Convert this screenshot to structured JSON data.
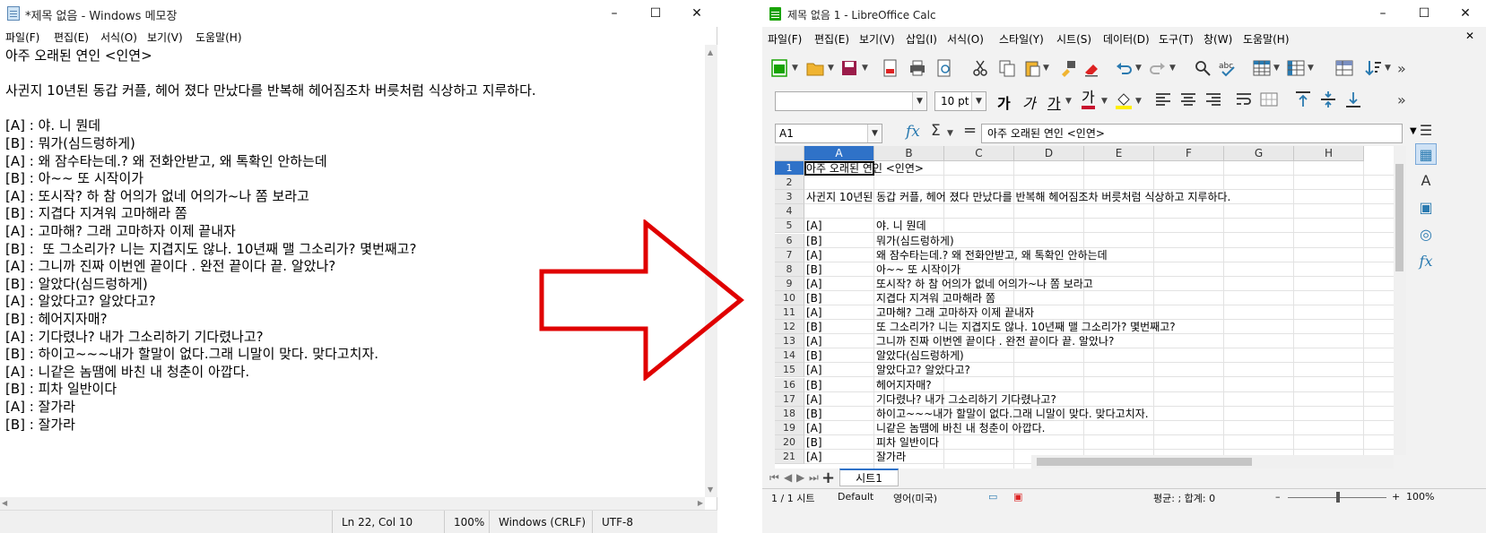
{
  "notepad": {
    "title": "*제목 없음 - Windows 메모장",
    "menu": [
      "파일(F)",
      "편집(E)",
      "서식(O)",
      "보기(V)",
      "도움말(H)"
    ],
    "lines": [
      "아주 오래된 연인 <인연>",
      "",
      "사귄지 10년된 동갑 커플, 헤어 졌다 만났다를 반복해 헤어짐조차 버릇처럼 식상하고 지루하다.",
      "",
      "[A] : 야. 니 뭔데",
      "[B] : 뭐가(심드렁하게)",
      "[A] : 왜 잠수타는데.? 왜 전화안받고, 왜 톡확인 안하는데",
      "[B] : 아~~ 또 시작이가",
      "[A] : 또시작? 하 참 어의가 없네 어의가~나 쫌 보라고",
      "[B] : 지겹다 지겨워 고마해라 쫌",
      "[A] : 고마해? 그래 고마하자 이제 끝내자",
      "[B] :  또 그소리가? 니는 지겹지도 않나. 10년째 맬 그소리가? 몇번째고?",
      "[A] : 그니까 진짜 이번엔 끝이다 . 완전 끝이다 끝. 알았나?",
      "[B] : 알았다(심드렁하게)",
      "[A] : 알았다고? 알았다고?",
      "[B] : 헤어지자매?",
      "[A] : 기다렸나? 내가 그소리하기 기다렸나고?",
      "[B] : 하이고~~~내가 할말이 없다.그래 니말이 맞다. 맞다고치자.",
      "[A] : 니같은 놈땜에 바친 내 청춘이 아깝다.",
      "[B] : 피차 일반이다",
      "[A] : 잘가라",
      "[B] : 잘가라"
    ],
    "status": {
      "position": "Ln 22, Col 10",
      "zoom": "100%",
      "line_ending": "Windows (CRLF)",
      "encoding": "UTF-8"
    }
  },
  "calc": {
    "title": "제목 없음 1 - LibreOffice Calc",
    "menu": [
      "파일(F)",
      "편집(E)",
      "보기(V)",
      "삽입(I)",
      "서식(O)",
      "스타일(Y)",
      "시트(S)",
      "데이터(D)",
      "도구(T)",
      "창(W)",
      "도움말(H)"
    ],
    "font_size": "10 pt",
    "name_box": "A1",
    "formula": "아주 오래된 연인 <인연>",
    "columns": [
      "A",
      "B",
      "C",
      "D",
      "E",
      "F",
      "G",
      "H"
    ],
    "rows": [
      {
        "n": "1",
        "a": "아주 오래된 연인 <인연>",
        "b": ""
      },
      {
        "n": "2",
        "a": "",
        "b": ""
      },
      {
        "n": "3",
        "a": "사귄지 10년된 동갑 커플, 헤어 졌다 만났다를 반복해 헤어짐조차 버릇처럼 식상하고 지루하다.",
        "b": ""
      },
      {
        "n": "4",
        "a": "",
        "b": ""
      },
      {
        "n": "5",
        "a": "[A]",
        "b": "야. 니 뭔데"
      },
      {
        "n": "6",
        "a": "[B]",
        "b": "뭐가(심드렁하게)"
      },
      {
        "n": "7",
        "a": "[A]",
        "b": "왜 잠수타는데.? 왜 전화안받고, 왜 톡확인 안하는데"
      },
      {
        "n": "8",
        "a": "[B]",
        "b": "아~~ 또 시작이가"
      },
      {
        "n": "9",
        "a": "[A]",
        "b": "또시작? 하 참 어의가 없네 어의가~나 쫌 보라고"
      },
      {
        "n": "10",
        "a": "[B]",
        "b": "지겹다 지겨워 고마해라 쫌"
      },
      {
        "n": "11",
        "a": "[A]",
        "b": "고마해? 그래 고마하자 이제 끝내자"
      },
      {
        "n": "12",
        "a": "[B]",
        "b": "또 그소리가? 니는 지겹지도 않나. 10년째 맬 그소리가? 몇번째고?"
      },
      {
        "n": "13",
        "a": "[A]",
        "b": "그니까 진짜 이번엔 끝이다 . 완전 끝이다 끝. 알았나?"
      },
      {
        "n": "14",
        "a": "[B]",
        "b": "알았다(심드렁하게)"
      },
      {
        "n": "15",
        "a": "[A]",
        "b": "알았다고? 알았다고?"
      },
      {
        "n": "16",
        "a": "[B]",
        "b": "헤어지자매?"
      },
      {
        "n": "17",
        "a": "[A]",
        "b": "기다렸나? 내가 그소리하기 기다렸나고?"
      },
      {
        "n": "18",
        "a": "[B]",
        "b": "하이고~~~내가 할말이 없다.그래 니말이 맞다. 맞다고치자."
      },
      {
        "n": "19",
        "a": "[A]",
        "b": "니같은 놈땜에 바친 내 청춘이 아깝다."
      },
      {
        "n": "20",
        "a": "[B]",
        "b": "피차 일반이다"
      },
      {
        "n": "21",
        "a": "[A]",
        "b": "잘가라"
      }
    ],
    "sheet_tab": "시트1",
    "status": {
      "sheet": "1 / 1 시트",
      "style": "Default",
      "language": "영어(미국)",
      "summary": "평균: ; 합계: 0",
      "zoom": "100%"
    }
  },
  "colors": {
    "arrow": "#e00000",
    "selection": "#2f72c8"
  }
}
